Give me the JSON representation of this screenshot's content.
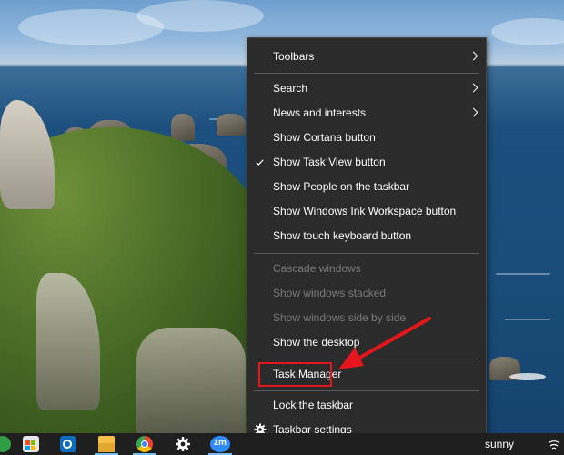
{
  "context_menu": {
    "items": [
      {
        "label": "Toolbars",
        "submenu": true,
        "enabled": true
      },
      {
        "label": "Search",
        "submenu": true,
        "enabled": true
      },
      {
        "label": "News and interests",
        "submenu": true,
        "enabled": true
      },
      {
        "label": "Show Cortana button",
        "enabled": true
      },
      {
        "label": "Show Task View button",
        "checked": true,
        "enabled": true
      },
      {
        "label": "Show People on the taskbar",
        "enabled": true
      },
      {
        "label": "Show Windows Ink Workspace button",
        "enabled": true
      },
      {
        "label": "Show touch keyboard button",
        "enabled": true
      },
      {
        "label": "Cascade windows",
        "enabled": false
      },
      {
        "label": "Show windows stacked",
        "enabled": false
      },
      {
        "label": "Show windows side by side",
        "enabled": false
      },
      {
        "label": "Show the desktop",
        "enabled": true
      },
      {
        "label": "Task Manager",
        "enabled": true,
        "highlighted": true
      },
      {
        "label": "Lock the taskbar",
        "enabled": true
      },
      {
        "label": "Taskbar settings",
        "icon": "gear-icon",
        "enabled": true
      }
    ]
  },
  "annotation": {
    "color": "#e4161b",
    "target": "Task Manager"
  },
  "taskbar": {
    "icons": [
      "app-green-icon",
      "microsoft-store-icon",
      "outlook-icon",
      "file-explorer-icon",
      "chrome-icon",
      "settings-gear-icon",
      "zoom-icon"
    ],
    "zoom_label": "zm",
    "tray_text": "sunny",
    "tray_icon": "wifi-icon",
    "accent_color": "#76b9ed"
  }
}
